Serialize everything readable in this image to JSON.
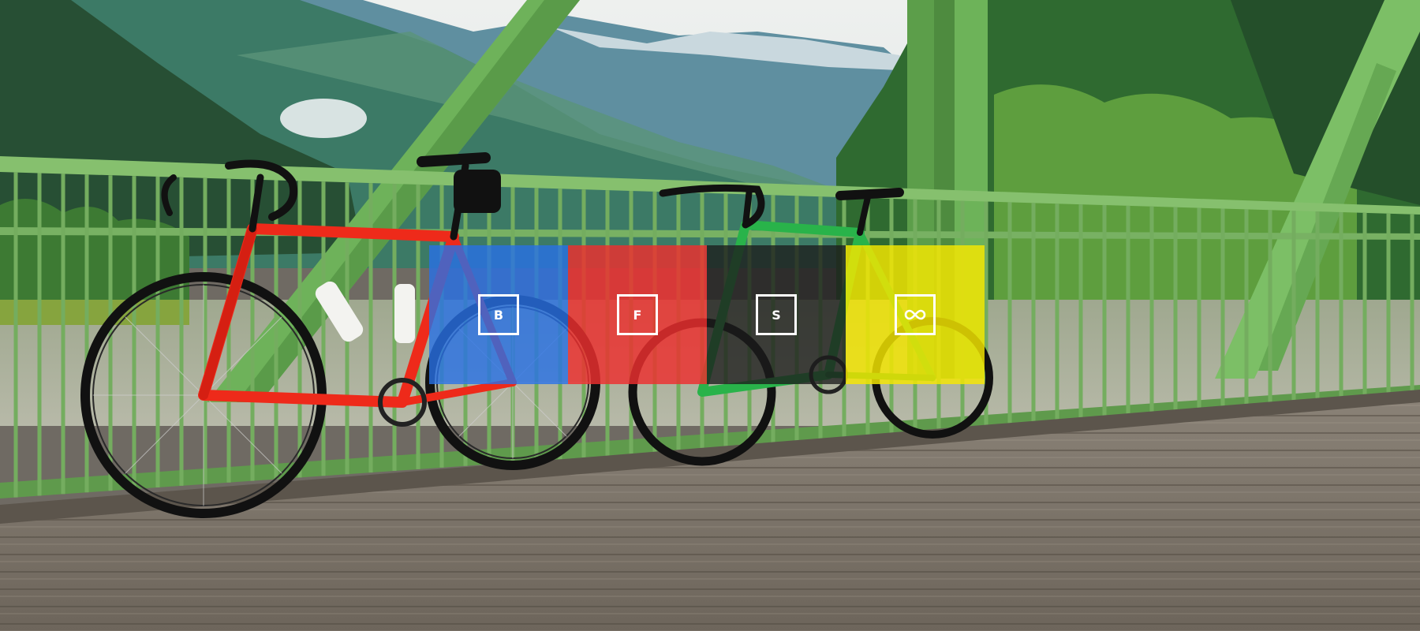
{
  "hero": {
    "scene_description_icon": "bicycles-on-bridge-photo",
    "tiles": [
      {
        "label": "B",
        "icon": "letter-b",
        "color": "#2870e6"
      },
      {
        "label": "F",
        "icon": "letter-f",
        "color": "#ee2e2e"
      },
      {
        "label": "S",
        "icon": "letter-s",
        "color": "#1c1c1c"
      },
      {
        "label": "",
        "icon": "infinity-icon",
        "color": "#f6e800"
      }
    ]
  }
}
